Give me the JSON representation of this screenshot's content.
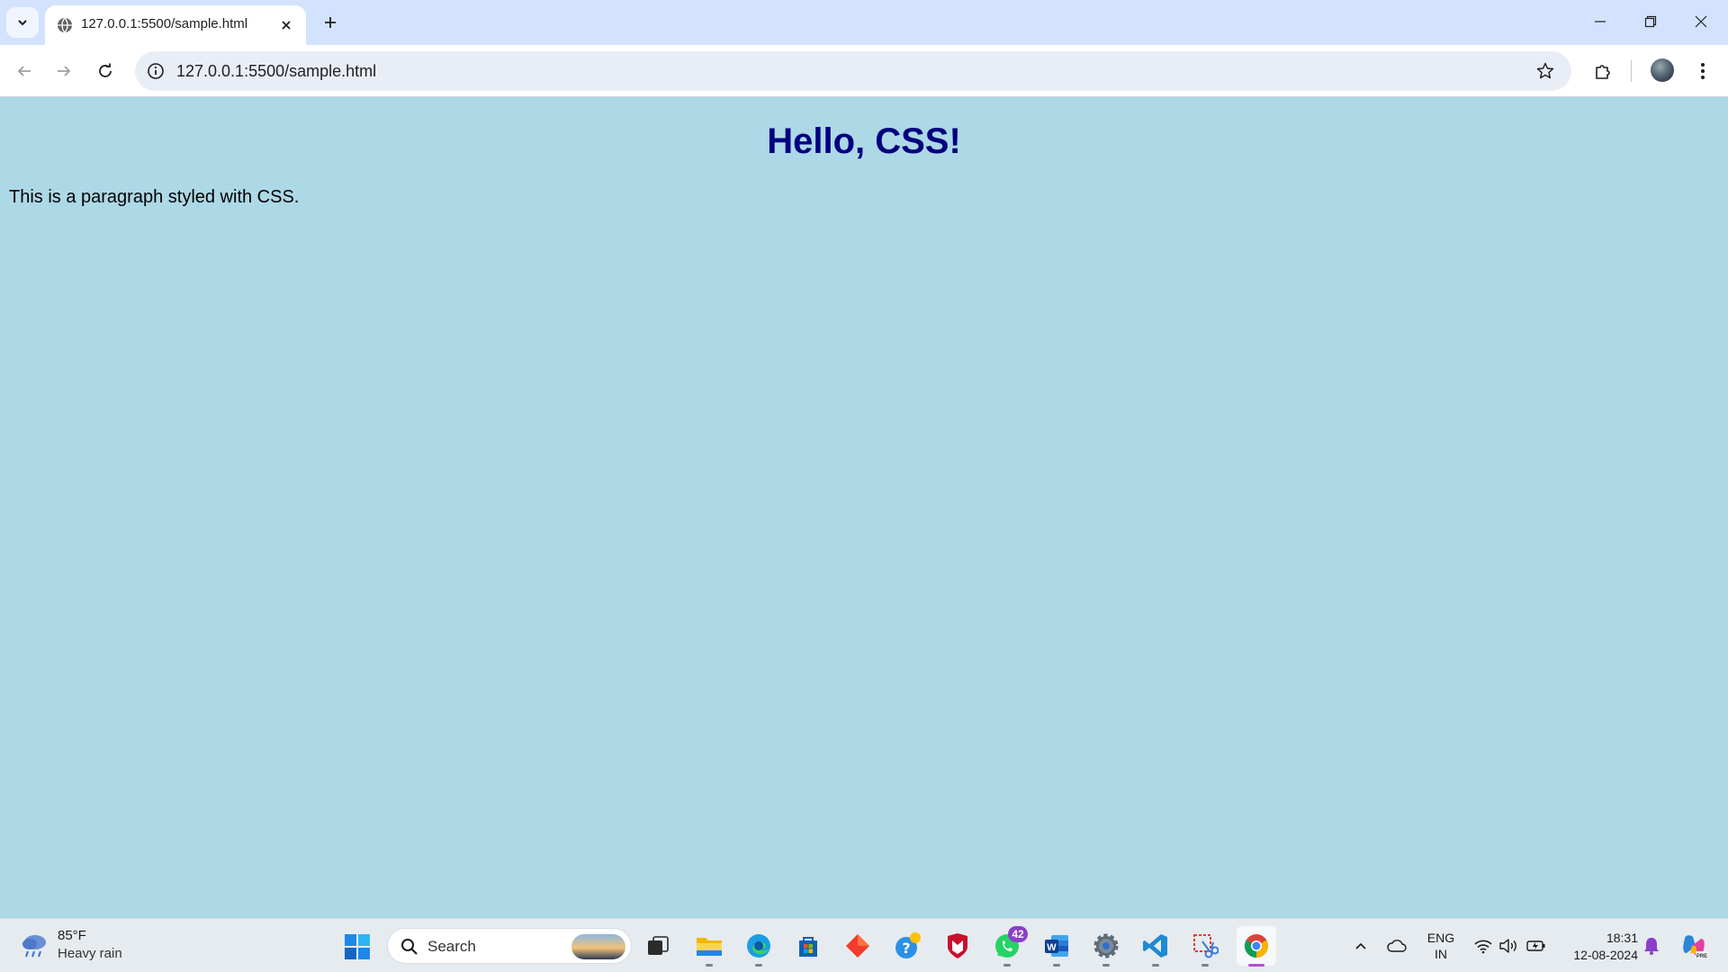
{
  "browser": {
    "tab": {
      "title": "127.0.0.1:5500/sample.html"
    },
    "address_bar": {
      "url": "127.0.0.1:5500/sample.html"
    }
  },
  "page": {
    "heading": "Hello, CSS!",
    "paragraph": "This is a paragraph styled with CSS.",
    "background_color": "#add8e6",
    "heading_color": "#000080"
  },
  "taskbar": {
    "weather": {
      "temperature": "85°F",
      "condition": "Heavy rain"
    },
    "search": {
      "placeholder": "Search"
    },
    "apps": [
      {
        "name": "task-view-icon"
      },
      {
        "name": "file-explorer-icon"
      },
      {
        "name": "edge-icon"
      },
      {
        "name": "microsoft-store-icon"
      },
      {
        "name": "red-diamond-app-icon"
      },
      {
        "name": "help-icon"
      },
      {
        "name": "mcafee-icon"
      },
      {
        "name": "whatsapp-icon",
        "badge": "42"
      },
      {
        "name": "word-icon"
      },
      {
        "name": "settings-icon"
      },
      {
        "name": "vscode-icon"
      },
      {
        "name": "snipping-tool-icon"
      },
      {
        "name": "chrome-icon",
        "active": true
      }
    ],
    "language": {
      "line1": "ENG",
      "line2": "IN"
    },
    "clock": {
      "time": "18:31",
      "date": "12-08-2024"
    }
  }
}
